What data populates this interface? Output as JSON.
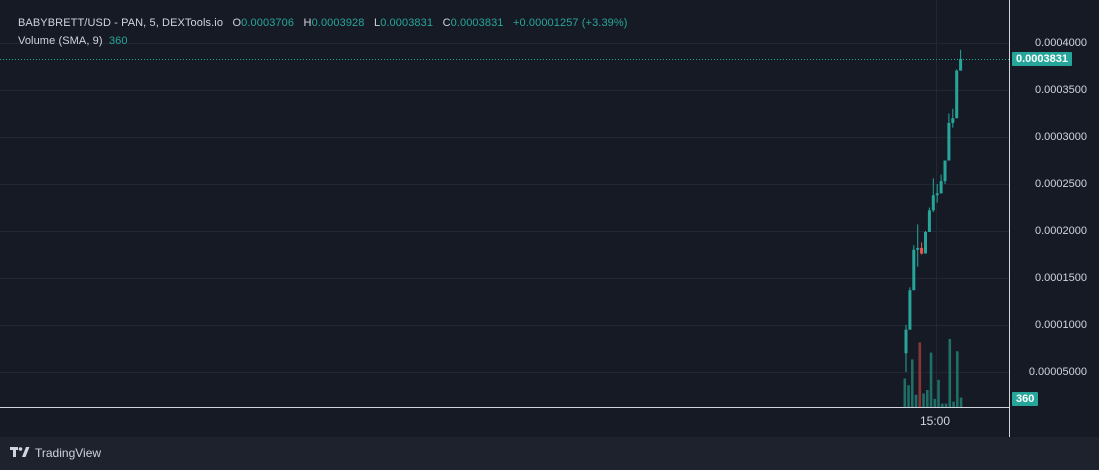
{
  "legend": {
    "symbol": "BABYBRETT/USD",
    "source": " - PAN, 5, DEXTools.io",
    "o_label": "O",
    "o_value": "0.0003706",
    "h_label": "H",
    "h_value": "0.0003928",
    "l_label": "L",
    "l_value": "0.0003831",
    "c_label": "C",
    "c_value": "0.0003831",
    "change": "+0.00001257 (+3.39%)",
    "volume_label": "Volume (SMA, 9)",
    "volume_value": "360"
  },
  "price_axis": {
    "ticks": [
      "0.0004000",
      "0.0003500",
      "0.0003000",
      "0.0002500",
      "0.0002000",
      "0.0001500",
      "0.0001000",
      "0.00005000"
    ],
    "last_price": "0.0003831",
    "volume_badge": "360"
  },
  "time_axis": {
    "label": "15:00"
  },
  "footer": {
    "brand": "TradingView",
    "logo_icon": "tradingview-logo-icon"
  },
  "colors": {
    "up": "#26a69a",
    "down": "#ef5350",
    "background": "#161a25",
    "grid": "#242733"
  },
  "chart_data": {
    "type": "candlestick",
    "ylim": [
      2e-05,
      0.00042
    ],
    "candles": [
      {
        "o": 7e-05,
        "h": 0.0001,
        "l": 5e-05,
        "c": 9.5e-05
      },
      {
        "o": 9.5e-05,
        "h": 0.00014,
        "l": 9.5e-05,
        "c": 0.000137
      },
      {
        "o": 0.000137,
        "h": 0.000185,
        "l": 0.000137,
        "c": 0.00018
      },
      {
        "o": 0.00018,
        "h": 0.000207,
        "l": 0.000162,
        "c": 0.000182
      },
      {
        "o": 0.000182,
        "h": 0.000188,
        "l": 0.000175,
        "c": 0.000176
      },
      {
        "o": 0.000176,
        "h": 0.0002,
        "l": 0.000176,
        "c": 0.000199
      },
      {
        "o": 0.000199,
        "h": 0.000225,
        "l": 0.000199,
        "c": 0.000222
      },
      {
        "o": 0.000222,
        "h": 0.000256,
        "l": 0.00022,
        "c": 0.000238
      },
      {
        "o": 0.000238,
        "h": 0.00025,
        "l": 0.00023,
        "c": 0.00024
      },
      {
        "o": 0.00024,
        "h": 0.00026,
        "l": 0.00024,
        "c": 0.000253
      },
      {
        "o": 0.000253,
        "h": 0.00027,
        "l": 0.00025,
        "c": 0.000275
      },
      {
        "o": 0.000275,
        "h": 0.000325,
        "l": 0.000275,
        "c": 0.000315
      },
      {
        "o": 0.000315,
        "h": 0.00033,
        "l": 0.00031,
        "c": 0.00032
      },
      {
        "o": 0.00032,
        "h": 0.000372,
        "l": 0.00032,
        "c": 0.0003706
      },
      {
        "o": 0.0003706,
        "h": 0.0003928,
        "l": 0.0003706,
        "c": 0.0003831
      }
    ],
    "volume": [
      {
        "v": 0.42,
        "up": true
      },
      {
        "v": 0.32,
        "up": true
      },
      {
        "v": 0.7,
        "up": true
      },
      {
        "v": 0.18,
        "up": true
      },
      {
        "v": 0.95,
        "up": false
      },
      {
        "v": 0.2,
        "up": true
      },
      {
        "v": 0.25,
        "up": true
      },
      {
        "v": 0.8,
        "up": true
      },
      {
        "v": 0.12,
        "up": true
      },
      {
        "v": 0.4,
        "up": true
      },
      {
        "v": 0.05,
        "up": true
      },
      {
        "v": 0.05,
        "up": true
      },
      {
        "v": 1.0,
        "up": true
      },
      {
        "v": 0.08,
        "up": true
      },
      {
        "v": 0.82,
        "up": true
      },
      {
        "v": 0.14,
        "up": true
      }
    ]
  }
}
